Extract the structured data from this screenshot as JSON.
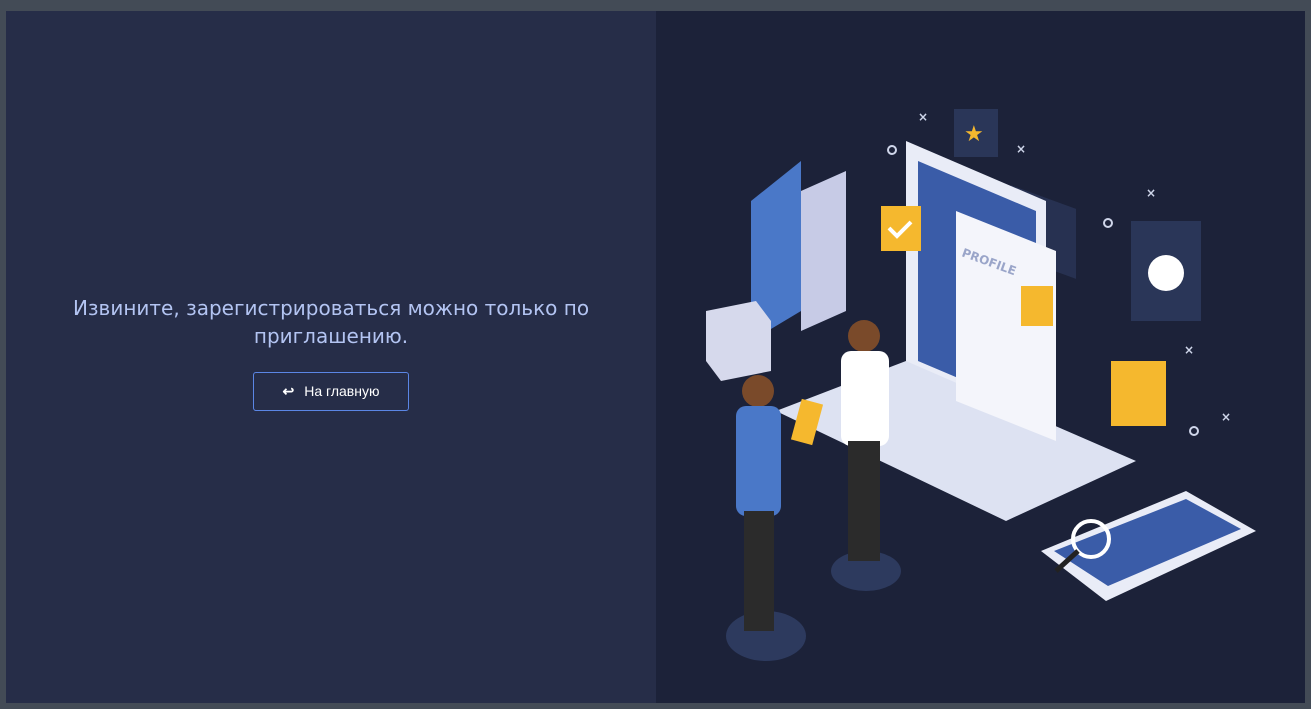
{
  "message": "Извините, зарегистрироваться можно только по приглашению.",
  "home_button": {
    "label": "На главную",
    "icon": "undo-arrow-icon"
  },
  "illustration": {
    "profile_label": "PROFILE"
  },
  "colors": {
    "left_bg": "#262d48",
    "right_bg": "#1c2239",
    "accent": "#5b86e5",
    "text": "#b3c4f2"
  }
}
